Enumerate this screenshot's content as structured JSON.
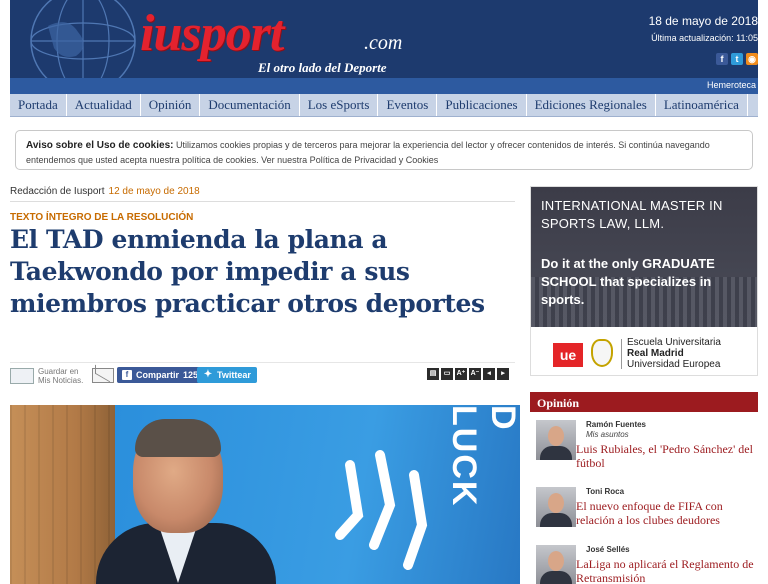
{
  "header": {
    "logo": "iusport",
    "logo_suffix": ".com",
    "tagline": "El otro lado del Deporte",
    "date": "18 de mayo de 2018",
    "updated": "Última actualización: 11:05",
    "hemeroteca": "Hemeroteca",
    "social_icons": [
      "facebook-icon",
      "twitter-icon",
      "rss-icon"
    ]
  },
  "nav": {
    "items": [
      "Portada",
      "Actualidad",
      "Opinión",
      "Documentación",
      "Los eSports",
      "Eventos",
      "Publicaciones",
      "Ediciones Regionales",
      "Latinoamérica"
    ]
  },
  "cookie": {
    "title": "Aviso sobre el Uso de cookies:",
    "text": "Utilizamos cookies propias y de terceros para mejorar la experiencia del lector y ofrecer contenidos de interés. Si continúa navegando entendemos que usted acepta nuestra política de cookies. Ver nuestra Política de Privacidad y Cookies"
  },
  "article": {
    "author": "Redacción de Iusport",
    "date": "12 de mayo de 2018",
    "kicker": "TEXTO ÍNTEGRO DE LA RESOLUCIÓN",
    "headline": "El TAD enmienda la plana a Taekwondo por impedir a sus miembros practicar otros deportes",
    "save_label": "Guardar en Mis Noticias.",
    "share_label": "Compartir",
    "share_count": "125",
    "tweet_label": "Twittear",
    "photo_text": "D LUCK"
  },
  "ad": {
    "line1": "INTERNATIONAL MASTER IN SPORTS LAW, LLM.",
    "line2": "Do it at the only GRADUATE SCHOOL that specializes in sports.",
    "ue_mark": "ue",
    "school_line1": "Escuela Universitaria",
    "school_line2": "Real Madrid",
    "school_line3": "Universidad Europea"
  },
  "opinion": {
    "title": "Opinión",
    "items": [
      {
        "author": "Ramón Fuentes",
        "blog": "Mis asuntos",
        "title": "Luis Rubiales, el 'Pedro Sánchez' del fútbol"
      },
      {
        "author": "Toni Roca",
        "blog": "",
        "title": "El nuevo enfoque de FIFA con relación a los clubes deudores"
      },
      {
        "author": "José Sellés",
        "blog": "",
        "title": "LaLiga no aplicará el Reglamento de Retransmisión"
      }
    ]
  },
  "colors": {
    "masthead": "#1d3a6e",
    "logo_red": "#e4222e",
    "nav_bg": "#c7d3e6",
    "kicker": "#c76b00",
    "headline": "#1e3c6e",
    "opinion_red": "#9c1b1f"
  }
}
